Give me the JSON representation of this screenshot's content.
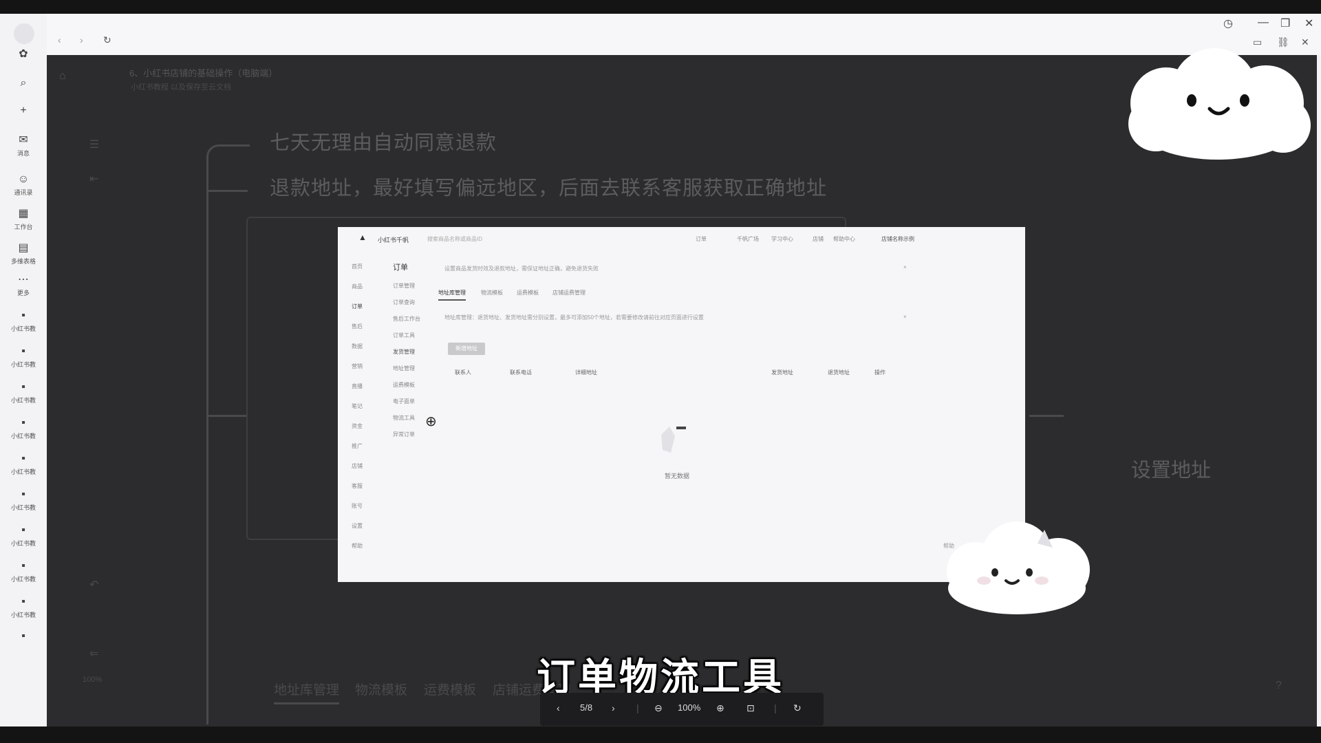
{
  "window": {
    "controls": [
      "history-icon",
      "minimize-icon",
      "restore-icon",
      "close-icon"
    ]
  },
  "chrome": {
    "back": "‹",
    "forward": "›",
    "reload": "↻"
  },
  "appbar": [
    {
      "label": "消息"
    },
    {
      "label": "通讯录"
    },
    {
      "label": "工作台"
    },
    {
      "label": "多维表格"
    },
    {
      "label": "更多"
    },
    {
      "label": "小红书教"
    },
    {
      "label": "小红书教"
    },
    {
      "label": "小红书教"
    },
    {
      "label": "小红书教"
    },
    {
      "label": "小红书教"
    },
    {
      "label": "小红书教"
    },
    {
      "label": "小红书教"
    },
    {
      "label": "小红书教"
    },
    {
      "label": "小红书教"
    }
  ],
  "doc": {
    "title": "6、小红书店铺的基础操作（电脑端）",
    "subtitle": "小红书教程    以及保存至云文档"
  },
  "mindmap": {
    "node1": "七天无理由自动同意退款",
    "node2": "退款地址，最好填写偏远地区，后面去联系客服获取正确地址",
    "node3": "设置地址"
  },
  "bottom_tabs": [
    "地址库管理",
    "物流模板",
    "运费模板",
    "店铺运费管理"
  ],
  "zoom_side": "100%",
  "screenshot": {
    "brand": "小红书千帆",
    "search_placeholder": "搜索商品名称或商品ID",
    "nav_links": [
      "订单",
      "千帆广场",
      "学习中心",
      "店铺",
      "帮助中心"
    ],
    "account": "店铺名称示例",
    "left_nav": [
      "首页",
      "商品",
      "订单",
      "售后",
      "数据",
      "营销",
      "直播",
      "笔记",
      "资金",
      "推广",
      "店铺",
      "客服",
      "账号",
      "设置",
      "帮助"
    ],
    "section_title": "订单",
    "sub_nav": [
      "订单管理",
      "订单查询",
      "售后工作台",
      "订单工具",
      "发货管理",
      "地址管理",
      "运费模板",
      "电子面单",
      "物流工具",
      "异常订单"
    ],
    "alert1": "设置商品发货时效及退款地址，需保证地址正确，避免退货失败",
    "tabs": [
      "地址库管理",
      "物流模板",
      "运费模板",
      "店铺运费管理"
    ],
    "alert2": "地址库管理：退货地址、发货地址需分别设置，最多可添加50个地址，若需要修改请前往对应页面进行设置",
    "add_button": "新增地址",
    "columns": [
      "联系人",
      "联系电话",
      "详细地址",
      "发货地址",
      "退货地址",
      "操作"
    ],
    "empty_text": "暂无数据",
    "help": "帮助"
  },
  "subtitle": "订单物流工具",
  "viewer": {
    "prev": "‹",
    "page": "5/8",
    "next": "›",
    "zoom_out": "zoom-out-icon",
    "zoom": "100%",
    "zoom_in": "zoom-in-icon",
    "fit": "fit-icon",
    "rotate": "rotate-icon"
  }
}
